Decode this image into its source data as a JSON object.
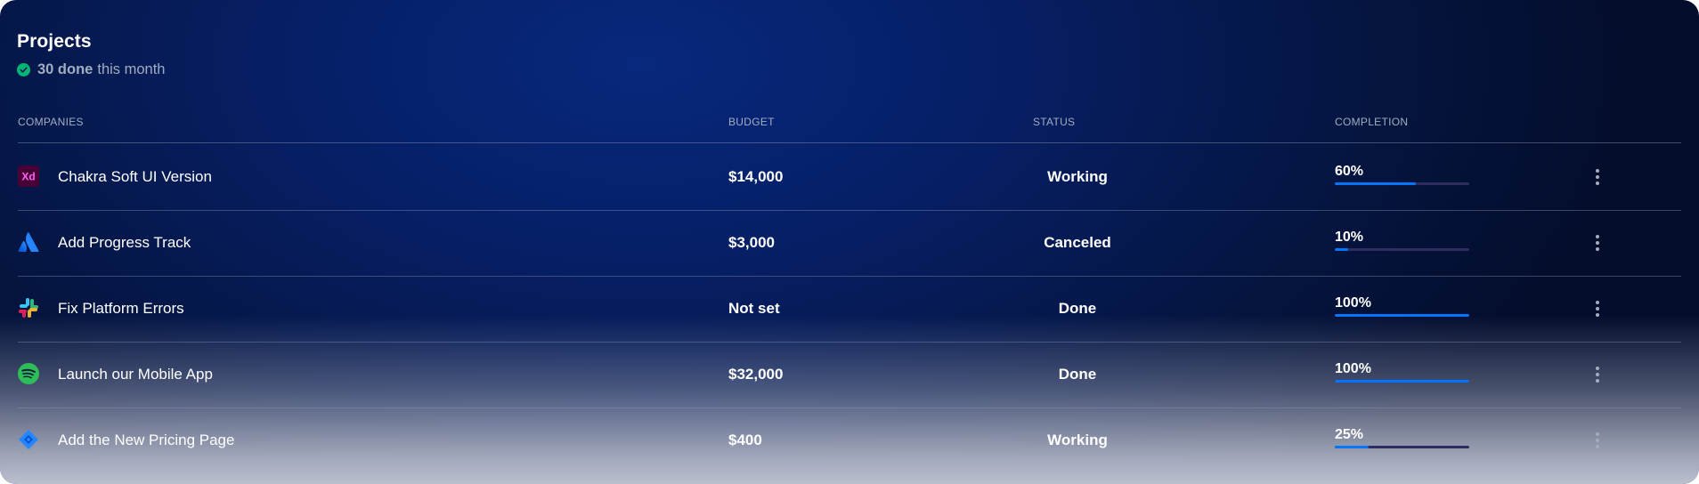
{
  "header": {
    "title": "Projects",
    "done_count": "30 done",
    "done_suffix": "this month"
  },
  "columns": {
    "companies": "COMPANIES",
    "budget": "BUDGET",
    "status": "STATUS",
    "completion": "COMPLETION"
  },
  "rows": [
    {
      "icon": "adobe-xd-icon",
      "name": "Chakra Soft UI Version",
      "budget": "$14,000",
      "status": "Working",
      "completion": 60,
      "completion_label": "60%"
    },
    {
      "icon": "atlassian-icon",
      "name": "Add Progress Track",
      "budget": "$3,000",
      "status": "Canceled",
      "completion": 10,
      "completion_label": "10%"
    },
    {
      "icon": "slack-icon",
      "name": "Fix Platform Errors",
      "budget": "Not set",
      "status": "Done",
      "completion": 100,
      "completion_label": "100%"
    },
    {
      "icon": "spotify-icon",
      "name": "Launch our Mobile App",
      "budget": "$32,000",
      "status": "Done",
      "completion": 100,
      "completion_label": "100%"
    },
    {
      "icon": "jira-icon",
      "name": "Add the New Pricing Page",
      "budget": "$400",
      "status": "Working",
      "completion": 25,
      "completion_label": "25%"
    }
  ],
  "colors": {
    "accent": "#0075ff",
    "done_check": "#01b574",
    "muted_text": "#a0aec0"
  }
}
